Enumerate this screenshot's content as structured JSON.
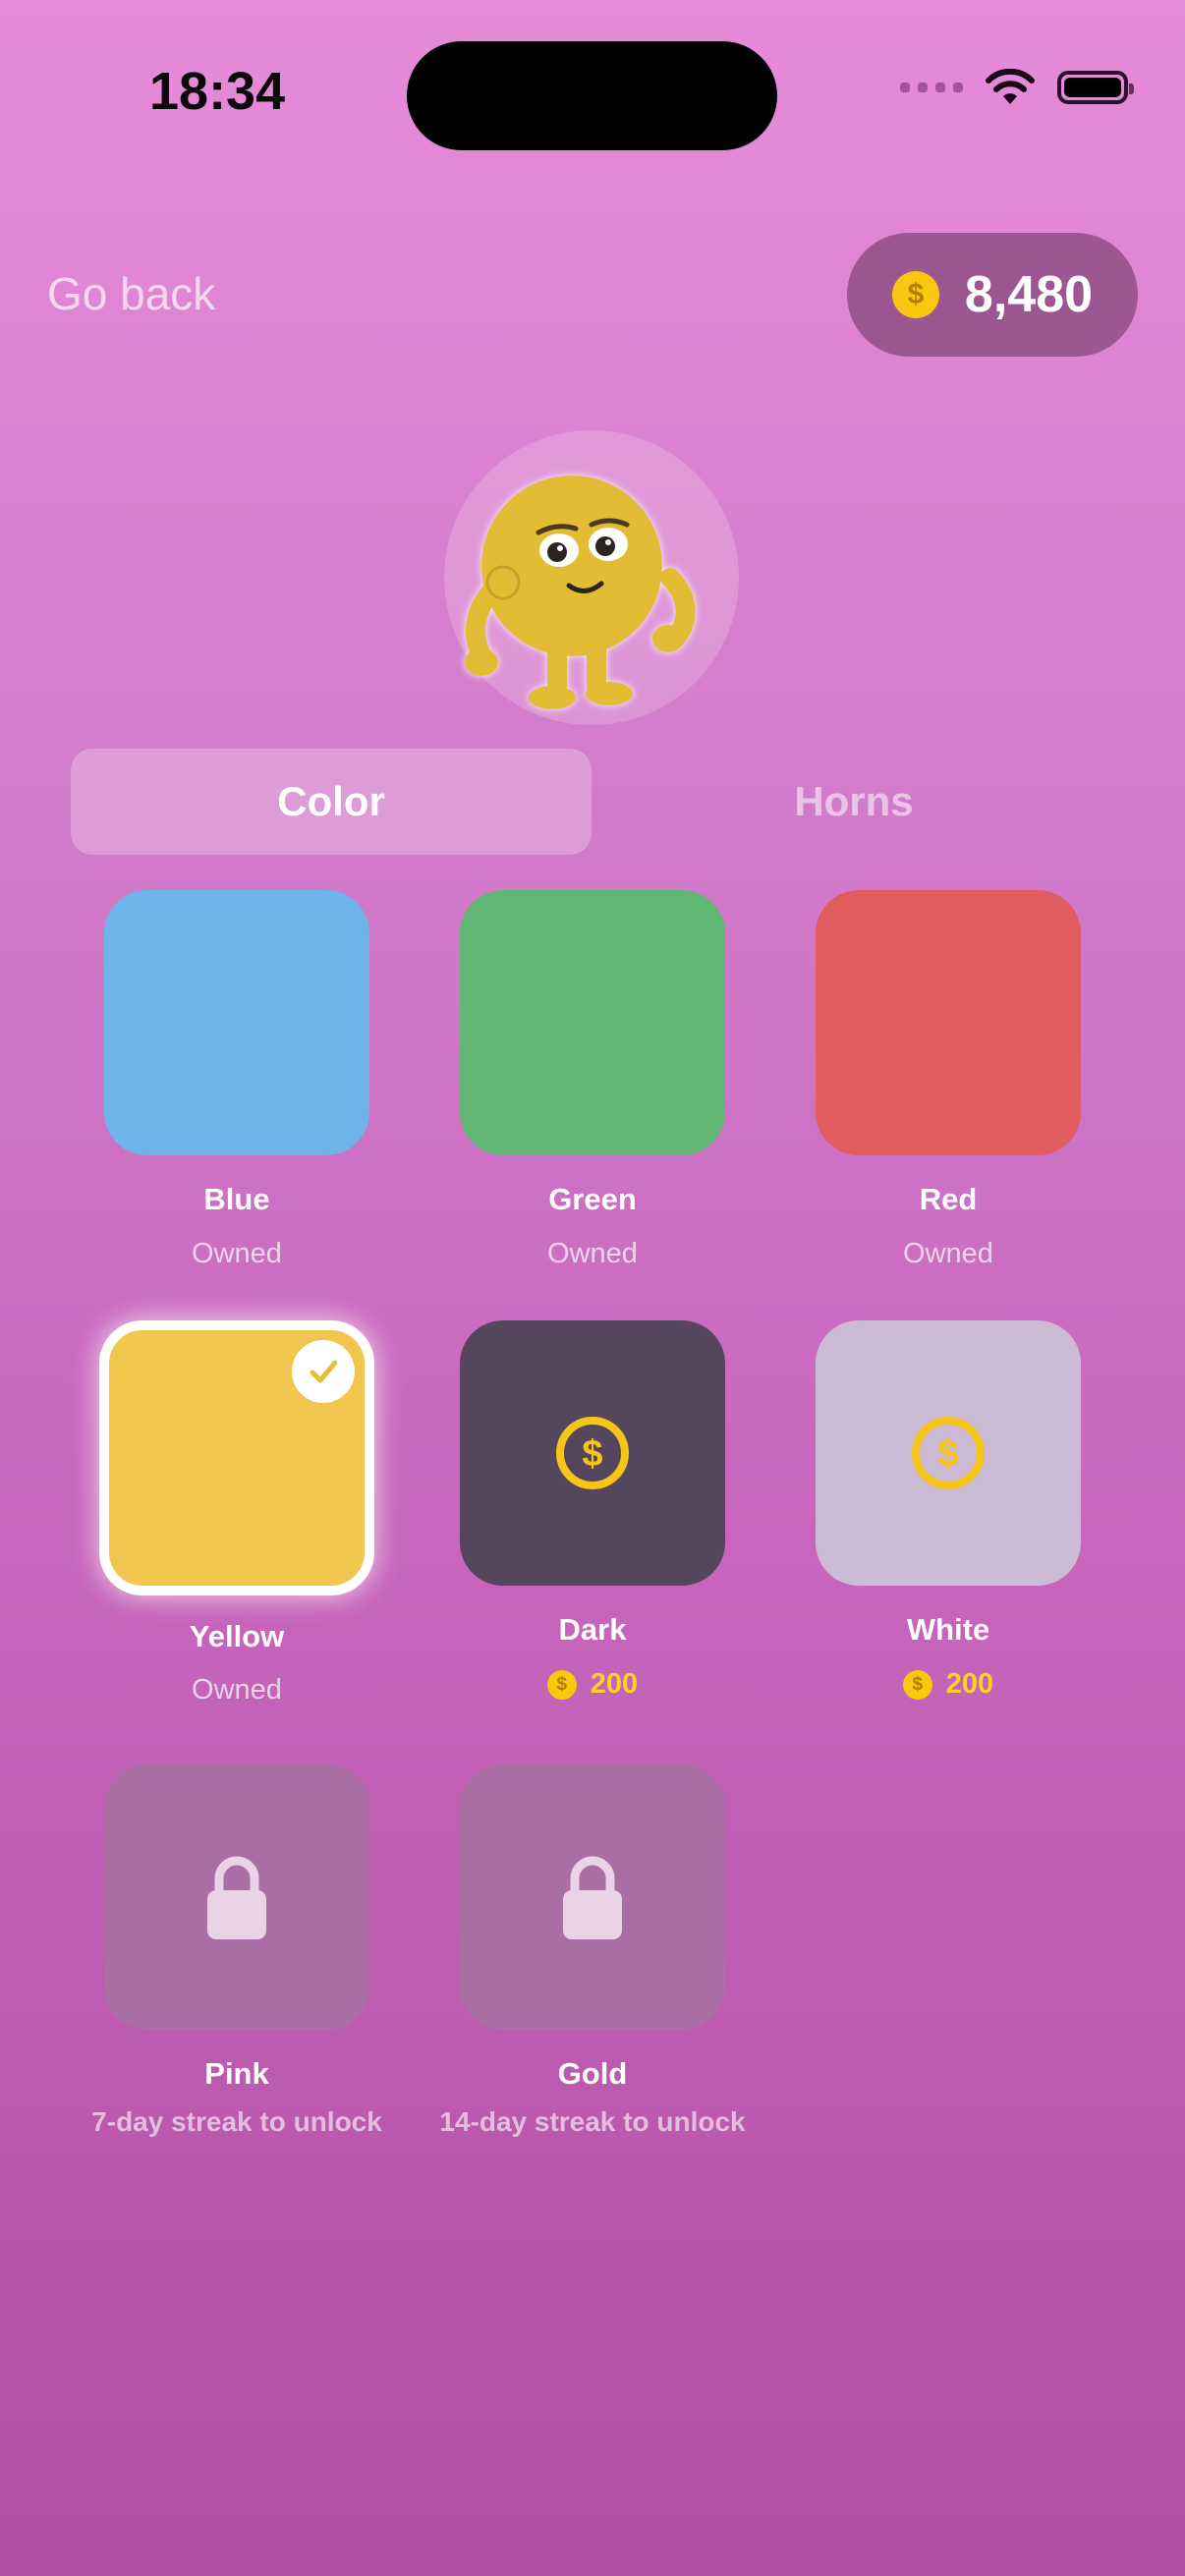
{
  "status_bar": {
    "time": "18:34"
  },
  "header": {
    "back_label": "Go back",
    "coin_icon": "$",
    "coins": "8,480"
  },
  "tabs": [
    {
      "label": "Color",
      "active": true
    },
    {
      "label": "Horns",
      "active": false
    }
  ],
  "items": [
    {
      "name": "Blue",
      "status": "Owned",
      "color": "#6CB4EA"
    },
    {
      "name": "Green",
      "status": "Owned",
      "color": "#62B673"
    },
    {
      "name": "Red",
      "status": "Owned",
      "color": "#E25D5E"
    },
    {
      "name": "Yellow",
      "status": "Owned",
      "color": "#F0C64E",
      "selected": true
    },
    {
      "name": "Dark",
      "price": "200",
      "color": "#56465D"
    },
    {
      "name": "White",
      "price": "200",
      "color": "#CDBAD4"
    },
    {
      "name": "Pink",
      "unlock": "7-day streak to unlock",
      "color": "#A96FA5"
    },
    {
      "name": "Gold",
      "unlock": "14-day streak to unlock",
      "color": "#A96FA5"
    }
  ],
  "price_coin": "$",
  "colors": {
    "accent_coin": "#F9C80E",
    "price_text": "#FFD21F"
  }
}
